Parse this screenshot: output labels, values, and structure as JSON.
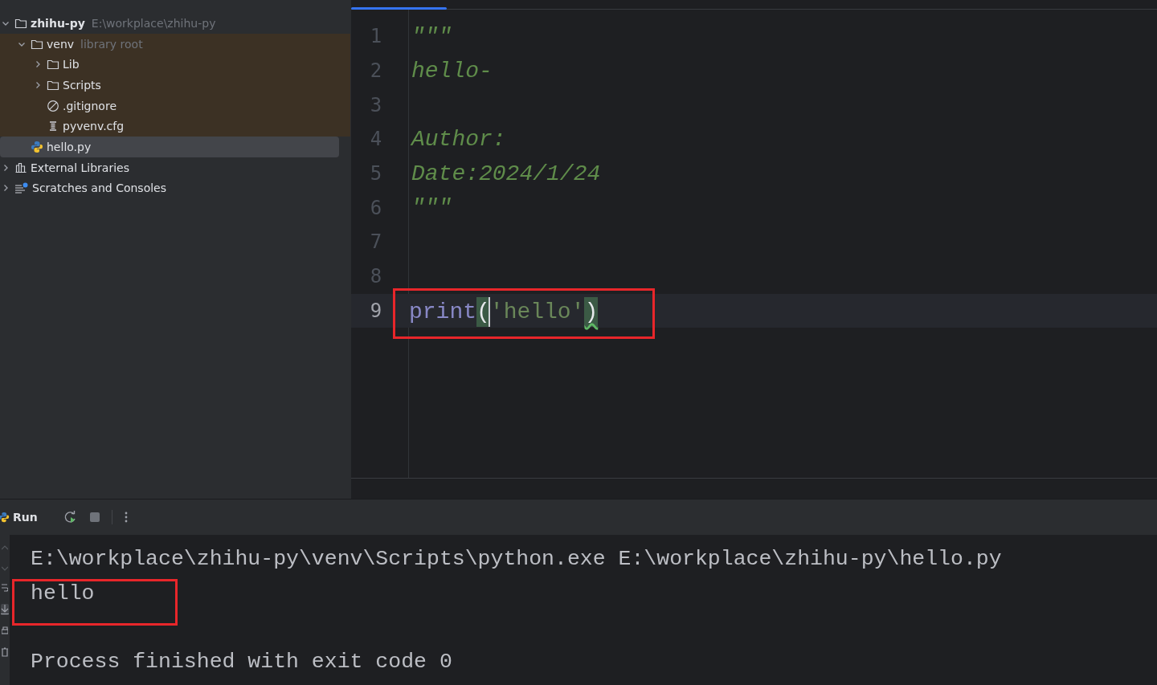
{
  "project_tree": [
    {
      "name": "zhihu-py",
      "hint": "E:\\workplace\\zhihu-py",
      "kind": "project",
      "expanded": true,
      "selected": false,
      "children": [
        {
          "name": "venv",
          "hint": "library root",
          "kind": "folder",
          "expanded": true,
          "selected": false,
          "library_root": true,
          "children": [
            {
              "name": "Lib",
              "kind": "folder",
              "expanded": false,
              "selected": false
            },
            {
              "name": "Scripts",
              "kind": "folder",
              "expanded": false,
              "selected": false
            },
            {
              "name": ".gitignore",
              "kind": "ignore-file",
              "selected": false
            },
            {
              "name": "pyvenv.cfg",
              "kind": "config-file",
              "selected": false
            }
          ]
        },
        {
          "name": "hello.py",
          "kind": "python-file",
          "selected": true
        }
      ]
    },
    {
      "name": "External Libraries",
      "kind": "libraries",
      "expanded": false,
      "selected": false
    },
    {
      "name": "Scratches and Consoles",
      "kind": "scratches",
      "expanded": false,
      "selected": false
    }
  ],
  "editor": {
    "lines": [
      {
        "number": "1",
        "current": false,
        "annotated": false,
        "tokens": [
          {
            "text": "\"\"\"",
            "kind": "docstring"
          }
        ]
      },
      {
        "number": "2",
        "current": false,
        "annotated": false,
        "tokens": [
          {
            "text": "hello-",
            "kind": "docstring"
          }
        ]
      },
      {
        "number": "3",
        "current": false,
        "annotated": false
      },
      {
        "number": "4",
        "current": false,
        "annotated": false,
        "tokens": [
          {
            "text": "Author:",
            "kind": "docstring"
          }
        ]
      },
      {
        "number": "5",
        "current": false,
        "annotated": false,
        "tokens": [
          {
            "text": "Date:2024/1/24",
            "kind": "docstring"
          }
        ]
      },
      {
        "number": "6",
        "current": false,
        "annotated": false,
        "tokens": [
          {
            "text": "\"\"\"",
            "kind": "docstring"
          }
        ]
      },
      {
        "number": "7",
        "current": false,
        "annotated": false
      },
      {
        "number": "8",
        "current": false,
        "annotated": false
      },
      {
        "number": "9",
        "current": true,
        "annotated": true,
        "tokens": [
          {
            "text": "print",
            "kind": "builtin",
            "caret": false,
            "warning": false
          },
          {
            "text": "(",
            "kind": "bracket-matched",
            "caret": true,
            "warning": false
          },
          {
            "text": "'hello'",
            "kind": "string",
            "caret": false,
            "warning": false
          },
          {
            "text": ")",
            "kind": "bracket-matched",
            "caret": false,
            "warning": true
          }
        ]
      }
    ]
  },
  "run_panel": {
    "tab": {
      "label": "Run",
      "selected": true
    },
    "console": [
      {
        "text": "E:\\workplace\\zhihu-py\\venv\\Scripts\\python.exe E:\\workplace\\zhihu-py\\hello.py",
        "kind": "command",
        "annotated": false
      },
      {
        "text": "hello",
        "kind": "output",
        "annotated": true
      },
      {
        "text": "Process finished with exit code 0",
        "kind": "status",
        "annotated": false
      }
    ]
  }
}
